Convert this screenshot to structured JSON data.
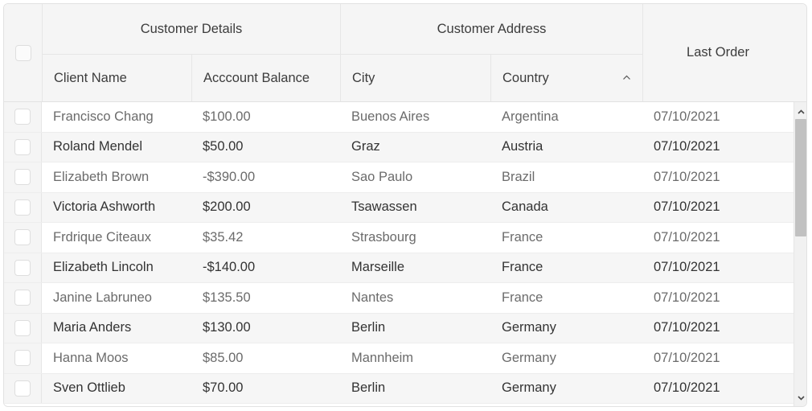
{
  "grid": {
    "header_groups": [
      {
        "label": "",
        "name": "select-all-group"
      },
      {
        "label": "Customer Details",
        "name": "group-customer-details"
      },
      {
        "label": "Customer Address",
        "name": "group-customer-address"
      },
      {
        "label": "Last Order",
        "name": "group-last-order"
      }
    ],
    "columns": [
      {
        "label": "Client Name",
        "name": "column-client-name",
        "sort": "none"
      },
      {
        "label": "Acccount Balance",
        "name": "column-account-balance",
        "sort": "none"
      },
      {
        "label": "City",
        "name": "column-city",
        "sort": "none"
      },
      {
        "label": "Country",
        "name": "column-country",
        "sort": "asc"
      },
      {
        "label": "Last Order",
        "name": "column-last-order",
        "sort": "none"
      }
    ],
    "sort_icon": "chevron-up-icon",
    "colors": {
      "positive": "#00a400",
      "warning": "#ffa500",
      "negative": "#fc0000",
      "header_bg": "#f5f5f5",
      "row_alt_bg": "#f6f6f6",
      "border": "#e6e6e6"
    },
    "rows": [
      {
        "name": "Francisco Chang",
        "balance": "$100.00",
        "balance_state": "positive",
        "city": "Buenos Aires",
        "country": "Argentina",
        "last_order": "07/10/2021"
      },
      {
        "name": "Roland Mendel",
        "balance": "$50.00",
        "balance_state": "warning",
        "city": "Graz",
        "country": "Austria",
        "last_order": "07/10/2021"
      },
      {
        "name": "Elizabeth Brown",
        "balance": "-$390.00",
        "balance_state": "negative",
        "city": "Sao Paulo",
        "country": "Brazil",
        "last_order": "07/10/2021"
      },
      {
        "name": "Victoria Ashworth",
        "balance": "$200.00",
        "balance_state": "positive",
        "city": "Tsawassen",
        "country": "Canada",
        "last_order": "07/10/2021"
      },
      {
        "name": "Frdrique Citeaux",
        "balance": "$35.42",
        "balance_state": "warning",
        "city": "Strasbourg",
        "country": "France",
        "last_order": "07/10/2021"
      },
      {
        "name": "Elizabeth Lincoln",
        "balance": "-$140.00",
        "balance_state": "negative",
        "city": "Marseille",
        "country": "France",
        "last_order": "07/10/2021"
      },
      {
        "name": "Janine Labruneo",
        "balance": "$135.50",
        "balance_state": "positive",
        "city": "Nantes",
        "country": "France",
        "last_order": "07/10/2021"
      },
      {
        "name": "Maria Anders",
        "balance": "$130.00",
        "balance_state": "positive",
        "city": "Berlin",
        "country": "Germany",
        "last_order": "07/10/2021"
      },
      {
        "name": "Hanna Moos",
        "balance": "$85.00",
        "balance_state": "warning",
        "city": "Mannheim",
        "country": "Germany",
        "last_order": "07/10/2021"
      },
      {
        "name": "Sven Ottlieb",
        "balance": "$70.00",
        "balance_state": "warning",
        "city": "Berlin",
        "country": "Germany",
        "last_order": "07/10/2021"
      }
    ],
    "scrollbar": {
      "up_icon": "chevron-up-icon",
      "down_icon": "chevron-down-icon"
    }
  }
}
